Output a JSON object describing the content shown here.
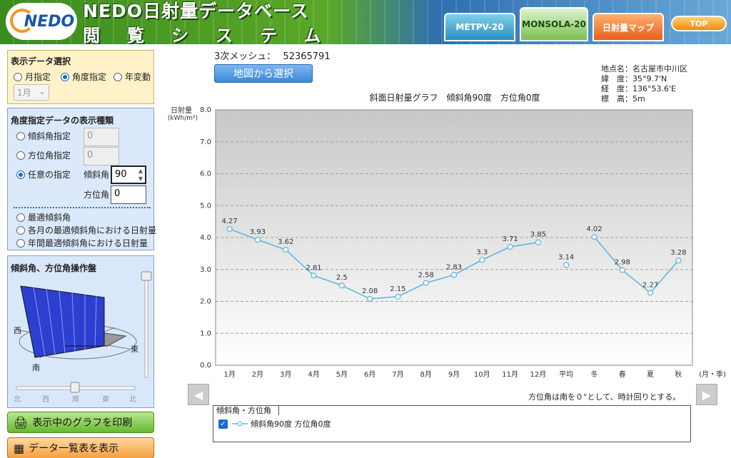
{
  "header": {
    "logo_text": "NEDO",
    "title": "NEDO日射量データベース",
    "subtitle": "閲覧システム",
    "tabs": [
      {
        "label": "METPV-20"
      },
      {
        "label": "MONSOLA-20"
      },
      {
        "label": "日射量マップ"
      },
      {
        "label": "TOP"
      }
    ]
  },
  "display_panel": {
    "title": "表示データ選択",
    "options": [
      "月指定",
      "角度指定",
      "年変動"
    ],
    "selected": "角度指定",
    "month_select": "1月"
  },
  "angle_panel": {
    "title": "角度指定データの表示種類",
    "tilt_spec": {
      "label": "傾斜角指定",
      "value": "0"
    },
    "azimuth_spec": {
      "label": "方位角指定",
      "value": "0"
    },
    "custom": {
      "label": "任意の指定",
      "tilt_label": "傾斜角",
      "tilt_value": "90",
      "azimuth_label": "方位角",
      "azimuth_value": "0"
    },
    "optimal": [
      "最適傾斜角",
      "各月の最適傾斜角における日射量",
      "年間最適傾斜角における日射量"
    ]
  },
  "control_panel": {
    "title": "傾斜角、方位角操作盤",
    "labels": {
      "west": "西",
      "south": "南",
      "east": "東"
    },
    "scale": [
      "北",
      "西",
      "南",
      "東",
      "北"
    ]
  },
  "buttons": {
    "print": "表示中のグラフを印刷",
    "table": "データ一覧表を表示",
    "map_select": "地図から選択"
  },
  "mesh": {
    "label": "3次メッシュ：",
    "value": "52365791"
  },
  "location": {
    "name": "地点名：名古屋市中川区",
    "lat": "緯　度：35°9.7'N",
    "lon": "経　度：136°53.6'E",
    "alt": "標　高：5m"
  },
  "note": "方位角は南を０°として、時計回りとする。",
  "legend": {
    "tab": "傾斜角・方位角",
    "item": "傾斜角90度 方位角0度"
  },
  "chart_data": {
    "type": "line",
    "title": "斜面日射量グラフ　傾斜角90度　方位角0度",
    "ylabel": "日射量",
    "yunit": "(kWh/m²)",
    "xunit": "(月・季)",
    "ylim": [
      0,
      8
    ],
    "yticks": [
      "0.0",
      "1.0",
      "2.0",
      "3.0",
      "4.0",
      "5.0",
      "6.0",
      "7.0",
      "8.0"
    ],
    "grid": true,
    "categories": [
      "1月",
      "2月",
      "3月",
      "4月",
      "5月",
      "6月",
      "7月",
      "8月",
      "9月",
      "10月",
      "11月",
      "12月",
      "平均",
      "冬",
      "春",
      "夏",
      "秋"
    ],
    "values": [
      4.27,
      3.93,
      3.62,
      2.81,
      2.5,
      2.08,
      2.15,
      2.58,
      2.83,
      3.3,
      3.71,
      3.85,
      3.14,
      4.02,
      2.98,
      2.27,
      3.28
    ],
    "value_labels": [
      "4.27",
      "3.93",
      "3.62",
      "2.81",
      "2.5",
      "2.08",
      "2.15",
      "2.58",
      "2.83",
      "3.3",
      "3.71",
      "3.85",
      "3.14",
      "4.02",
      "2.98",
      "2.27",
      "3.28"
    ],
    "color": "#5ab4e0"
  }
}
